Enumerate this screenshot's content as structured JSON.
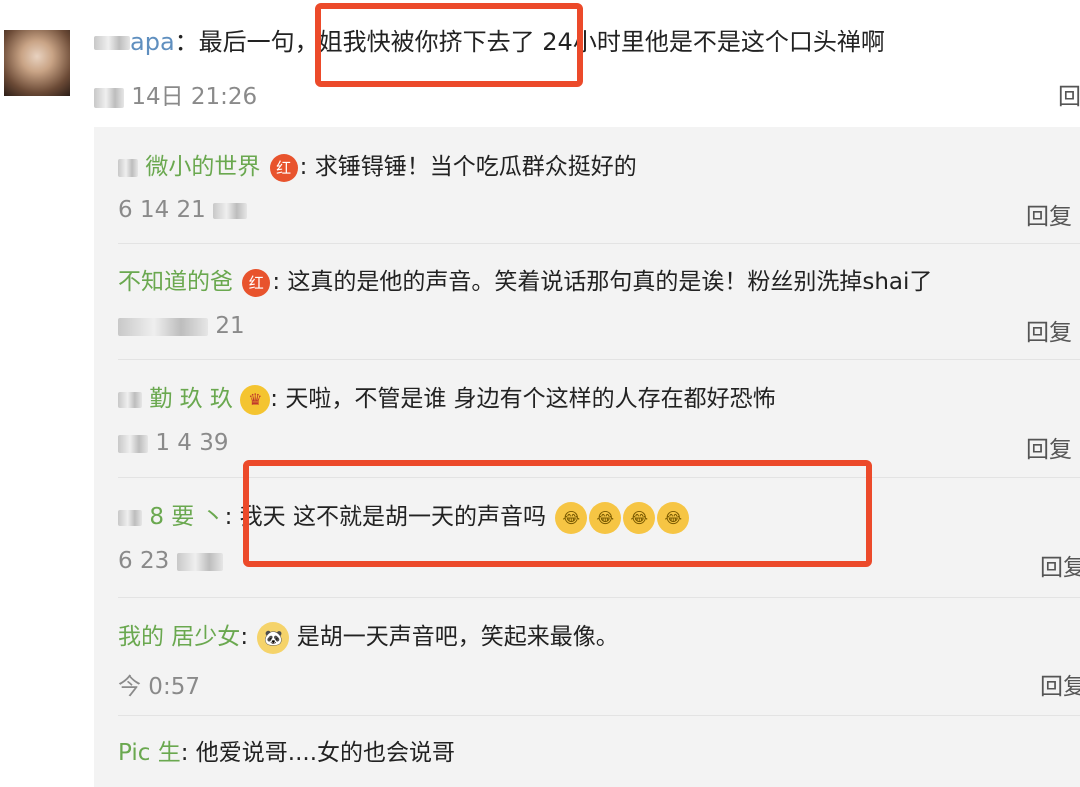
{
  "main_comment": {
    "username": "apa",
    "text": "最后一句，姐我快被你挤下去了 24小时里他是不是这个口头禅啊",
    "date": "14日 21:26",
    "reply_label": "回"
  },
  "replies": [
    {
      "username": "微小的世界",
      "suffix": ":",
      "badge": "红",
      "text": "求锤锝锤！当个吃瓜群众挺好的",
      "date": "6 14 21",
      "reply_label": "回复"
    },
    {
      "username": "不知道的爸",
      "suffix": ":",
      "badge": "红",
      "text": "这真的是他的声音。笑着说话那句真的是诶！粉丝别洗掉shai了",
      "date": "21",
      "reply_label": "回复"
    },
    {
      "username": "勤 玖 玖",
      "suffix": ":",
      "badge": "♛",
      "text": "天啦，不管是谁 身边有个这样的人存在都好恐怖",
      "date": "1 4 39",
      "reply_label": "回复"
    },
    {
      "username": "8 要 丶",
      "suffix": ":",
      "text": "我天 这不就是胡一天的声音吗",
      "emojis": [
        "😂",
        "😂",
        "😂",
        "😂"
      ],
      "date": "6 23",
      "reply_label": "回复"
    },
    {
      "username": "我的 居少女",
      "suffix": ":",
      "text": "是胡一天声音吧，笑起来最像。",
      "emoji_prefix": "🐼",
      "date": "今 0:57",
      "reply_label": "回复"
    },
    {
      "username": "Pic 生",
      "suffix": ":",
      "text": "他爱说哥....女的也会说哥"
    }
  ],
  "colors": {
    "highlight": "#ec4a2a",
    "username_blue": "#5f8fbf",
    "username_green": "#6aa84f",
    "reply_bg": "#f3f3f3"
  }
}
